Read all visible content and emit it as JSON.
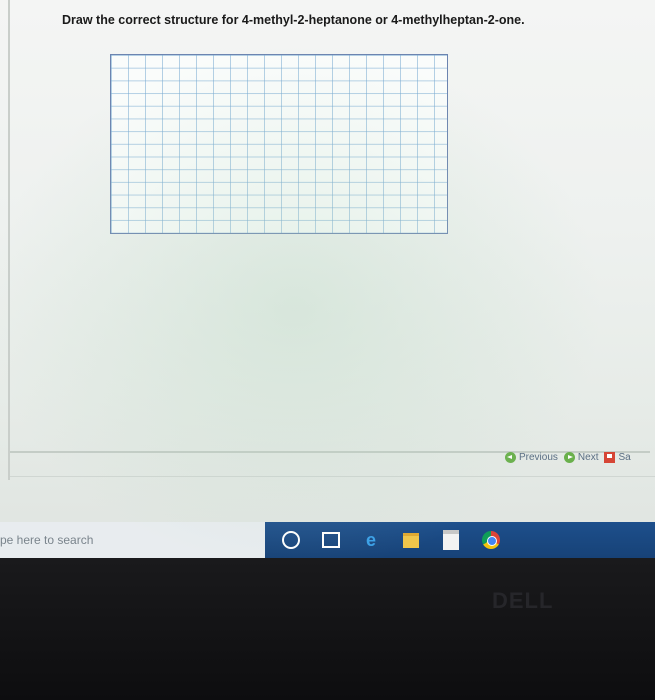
{
  "question": {
    "text": "Draw the correct structure for 4-methyl-2-heptanone or 4-methylheptan-2-one."
  },
  "navigation": {
    "previous_label": "Previous",
    "next_label": "Next",
    "save_label": "Sa"
  },
  "taskbar": {
    "search_text": "pe here to search"
  },
  "bezel": {
    "brand": "DELL"
  }
}
